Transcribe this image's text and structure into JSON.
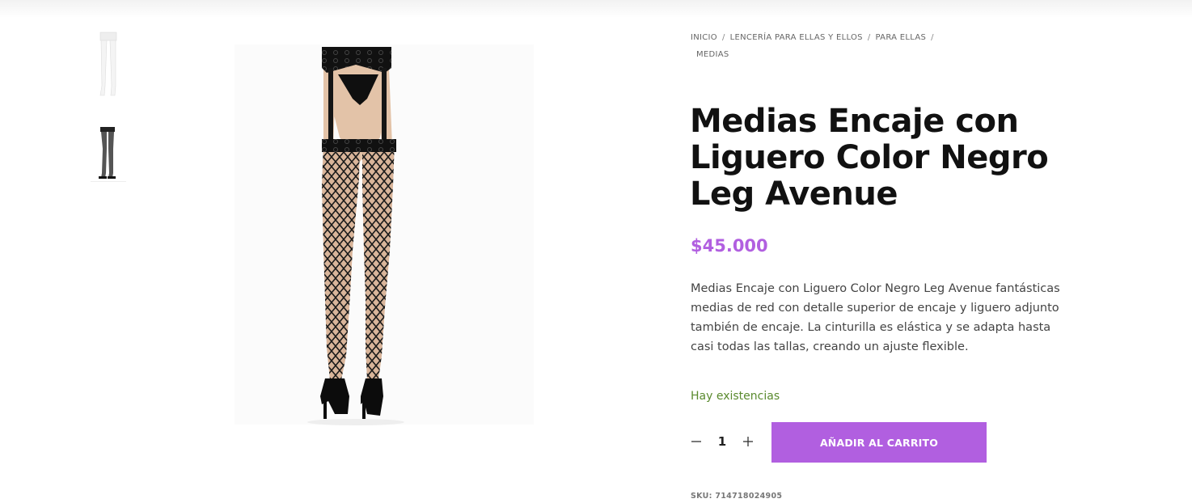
{
  "breadcrumb": {
    "items": [
      "INICIO",
      "LENCERÍA PARA ELLAS Y ELLOS",
      "PARA ELLAS"
    ],
    "current": "MEDIAS",
    "separator": "/"
  },
  "product": {
    "title": "Medias Encaje con Liguero Color Negro Leg Avenue",
    "price": "$45.000",
    "description": "Medias Encaje con Liguero Color Negro Leg Avenue fantásticas medias de red con detalle superior de encaje y liguero adjunto también de encaje. La cinturilla es elástica y se adapta hasta casi todas las tallas, creando un ajuste flexible.",
    "stock_status": "Hay existencias",
    "quantity": "1",
    "add_to_cart_label": "AÑADIR AL CARRITO",
    "sku_label": "SKU:",
    "sku_value": "714718024905"
  },
  "colors": {
    "accent": "#b15fe0",
    "stock": "#5a8a2e",
    "title": "#111111"
  },
  "icons": {
    "minus": "minus-icon",
    "plus": "plus-icon"
  }
}
